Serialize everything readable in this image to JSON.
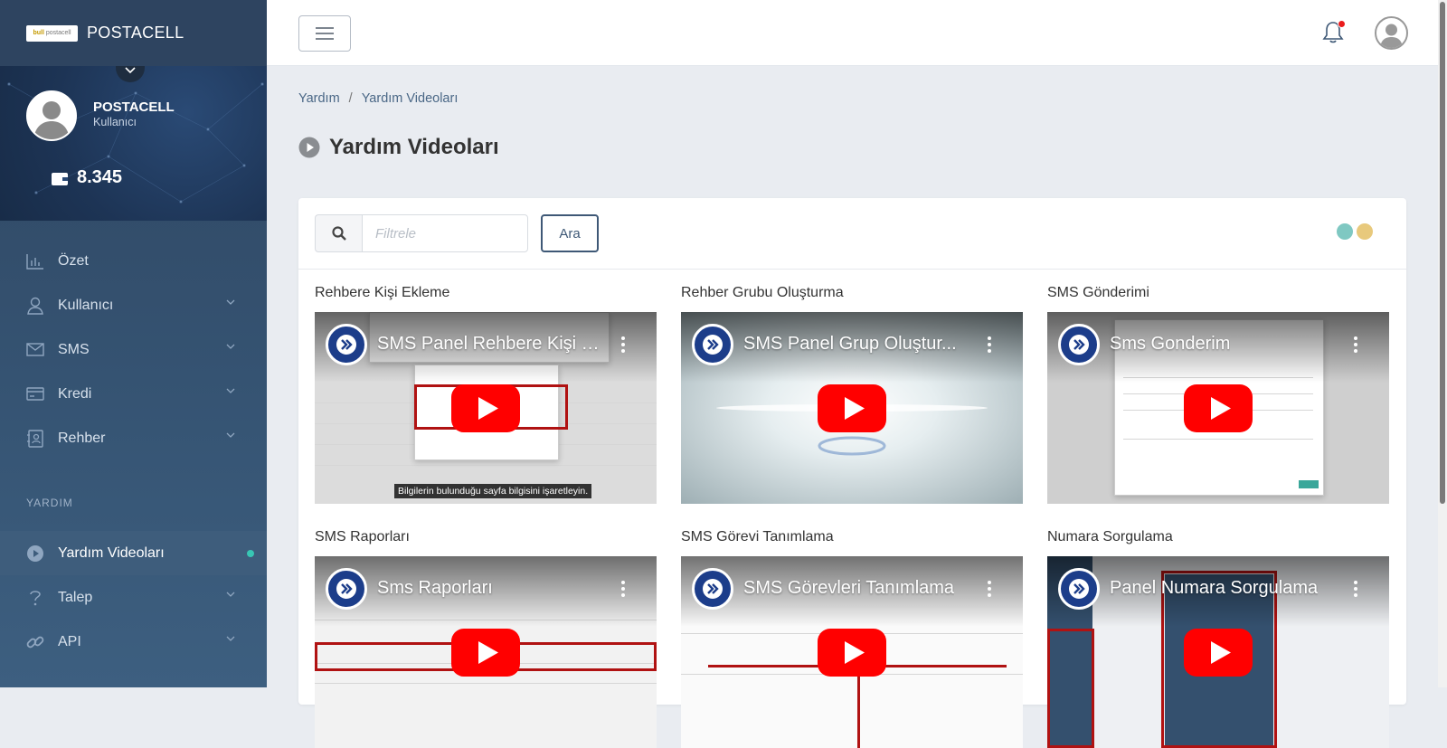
{
  "brand": {
    "logo_text": "bull",
    "logo_sub": "postacell",
    "name": "POSTACELL"
  },
  "profile": {
    "name": "POSTACELL",
    "role": "Kullanıcı",
    "balance": "8.345"
  },
  "nav": {
    "items": [
      {
        "label": "Özet",
        "icon": "chart-icon",
        "has_chevron": false
      },
      {
        "label": "Kullanıcı",
        "icon": "user-icon",
        "has_chevron": true
      },
      {
        "label": "SMS",
        "icon": "envelope-icon",
        "has_chevron": true
      },
      {
        "label": "Kredi",
        "icon": "credit-card-icon",
        "has_chevron": true
      },
      {
        "label": "Rehber",
        "icon": "contact-book-icon",
        "has_chevron": true
      }
    ],
    "section": "YARDIM",
    "help_items": [
      {
        "label": "Yardım Videoları",
        "icon": "play-circle-icon",
        "active": true
      },
      {
        "label": "Talep",
        "icon": "question-icon",
        "has_chevron": true
      },
      {
        "label": "API",
        "icon": "link-icon",
        "has_chevron": true
      }
    ]
  },
  "breadcrumb": {
    "root": "Yardım",
    "current": "Yardım Videoları"
  },
  "page": {
    "title": "Yardım Videoları"
  },
  "search": {
    "placeholder": "Filtrele",
    "value": "",
    "button": "Ara"
  },
  "colors": {
    "accent": "#3e5876",
    "teal_dot": "#7fc8c2",
    "gold_dot": "#e8c97c",
    "active_dot": "#38c6b4",
    "yt_red": "#ff0000"
  },
  "videos": [
    {
      "title": "Rehbere Kişi Ekleme",
      "video_title": "SMS Panel Rehbere Kişi E...",
      "caption": "Bilgilerin bulunduğu sayfa bilgisini işaretleyin."
    },
    {
      "title": "Rehber Grubu Oluşturma",
      "video_title": "SMS Panel Grup Oluştur...",
      "caption": ""
    },
    {
      "title": "SMS Gönderimi",
      "video_title": "Sms Gonderim",
      "caption": ""
    },
    {
      "title": "SMS Raporları",
      "video_title": "Sms Raporları",
      "caption": ""
    },
    {
      "title": "SMS Görevi Tanımlama",
      "video_title": "SMS Görevleri Tanımlama",
      "caption": ""
    },
    {
      "title": "Numara Sorgulama",
      "video_title": "Panel Numara Sorgulama",
      "caption": ""
    }
  ]
}
